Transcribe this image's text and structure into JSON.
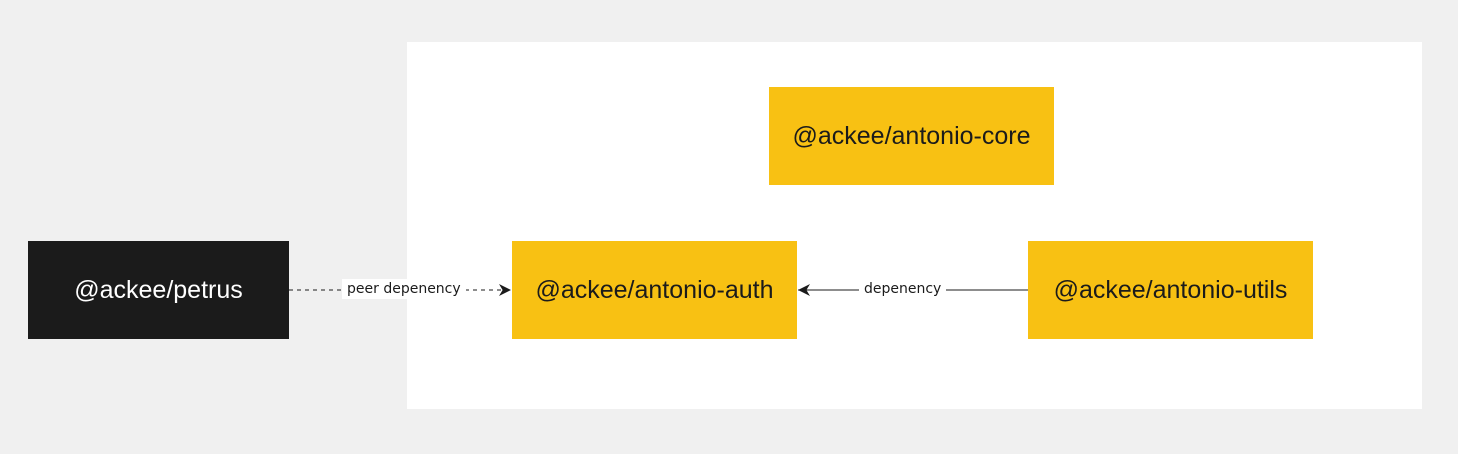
{
  "nodes": {
    "petrus": "@ackee/petrus",
    "core": "@ackee/antonio-core",
    "auth": "@ackee/antonio-auth",
    "utils": "@ackee/antonio-utils"
  },
  "edges": {
    "peer": "peer depenency",
    "dependency": "depenency"
  },
  "colors": {
    "background": "#f0f0f0",
    "group_panel": "#ffffff",
    "dark_node": "#1b1b1b",
    "yellow_node": "#f8c113",
    "edge_line": "#1b1b1b"
  }
}
